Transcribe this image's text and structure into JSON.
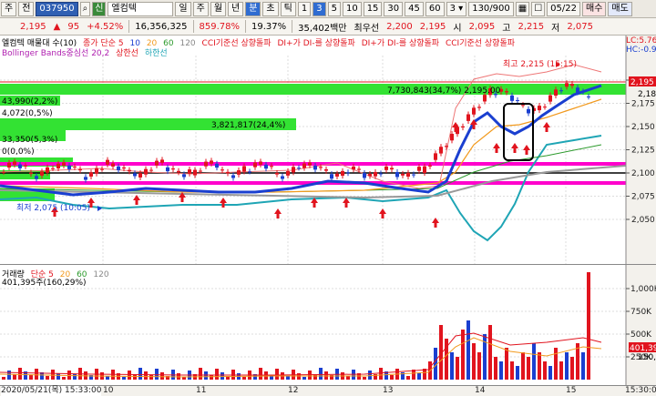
{
  "toolbar": {
    "market": "주",
    "mode": "전",
    "code": "037950",
    "credit_badge": "신",
    "stock_name": "엘컴텍",
    "periods": [
      "일",
      "주",
      "월",
      "년",
      "분",
      "초",
      "틱"
    ],
    "active_period": "분",
    "intervals": [
      "1",
      "3",
      "5",
      "10",
      "15",
      "30",
      "45",
      "60"
    ],
    "active_interval": "3",
    "interval_select": "3",
    "count": "130/900",
    "date": "05/22",
    "buy_label": "매수",
    "sell_label": "매도"
  },
  "quote": {
    "price": "2,195",
    "change": "95",
    "change_pct": "+4.52%",
    "volume": "16,356,325",
    "volume_pct": "859.78%",
    "turnover": "19.37%",
    "amount": "35,402백만",
    "best_ask_label": "최우선",
    "best_ask": "2,200",
    "best_bid": "2,195",
    "open_label": "시",
    "open": "2,095",
    "high_label": "고",
    "high": "2,215",
    "low_label": "저",
    "low": "2,075"
  },
  "price_legend": {
    "line1": [
      "엘컴텍 매물대 수(10)",
      "종가 단순 5",
      "10",
      "20",
      "60",
      "120",
      "CCI기준선 상향돌파",
      "DI+가 DI-를 상향돌파",
      "DI+가 DI-를 상향돌파",
      "CCI기준선 상향돌파"
    ],
    "line2": [
      "Bollinger Bands중심선 20,2",
      "상한선",
      "하한선"
    ]
  },
  "right_info": {
    "lc": "LC:5.76",
    "hc": "HC:-0.9"
  },
  "volume_profile": [
    {
      "label": "7,730,843(34,7%)",
      "price": "2,195"
    },
    {
      "label": "3,821,817(24,4%)",
      "price": ""
    },
    {
      "label": "43,990(2,2%)",
      "price": ""
    },
    {
      "label": "4,072(0,5%)",
      "price": ""
    },
    {
      "label": "33,350(5,3%)",
      "price": ""
    },
    {
      "label": "0(0,0%)",
      "price": ""
    }
  ],
  "annotations": {
    "high": "최고 2,215 (15:15)",
    "low": "최저 2,075 (10:05)",
    "profile_current": "7,730,843(34,7%) 2,195.00"
  },
  "price_axis": {
    "ticks": [
      "2,200",
      "2,175",
      "2,150",
      "2,125",
      "2,100",
      "2,075",
      "2,050"
    ],
    "current": "2,195",
    "marker2": "2,18"
  },
  "volume_legend": [
    "거래량",
    "단순 5",
    "20",
    "60",
    "120"
  ],
  "volume_info": "401,395주(160,29%)",
  "volume_axis": {
    "ticks": [
      "1,000K",
      "750K",
      "500K",
      "250K"
    ],
    "current": "401,39",
    "marker2": "150,29"
  },
  "x_axis": {
    "cursor": "2020/05/21(목) 15:33:00",
    "labels": [
      "10",
      "11",
      "12",
      "13",
      "14",
      "15"
    ],
    "right": "15:30:0"
  },
  "colors": {
    "up": "#e1141e",
    "down": "#1a3fd0",
    "profile": "#33e233",
    "magenta": "#ff00cc",
    "bb": "#1fa5b5"
  }
}
